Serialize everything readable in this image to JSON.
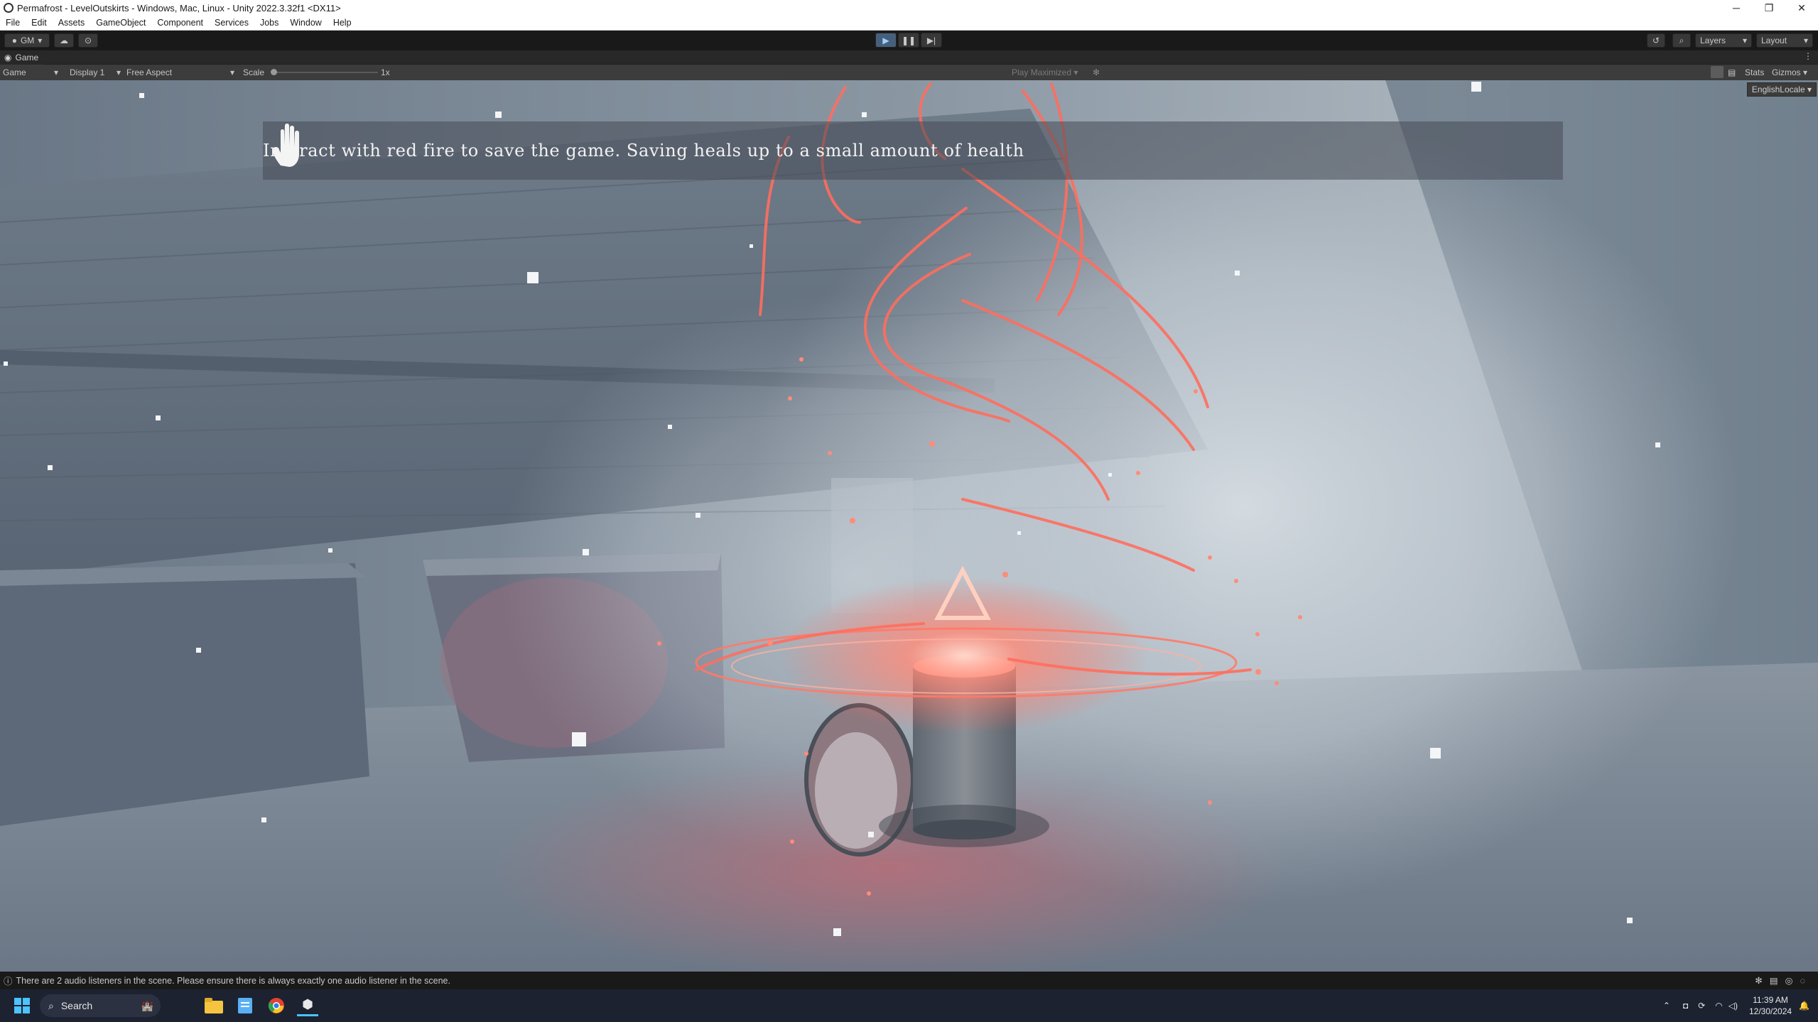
{
  "window": {
    "title": "Permafrost - LevelOutskirts - Windows, Mac, Linux - Unity 2022.3.32f1 <DX11>",
    "minimize_glyph": "─",
    "maximize_glyph": "❐",
    "close_glyph": "✕"
  },
  "menu": [
    "File",
    "Edit",
    "Assets",
    "GameObject",
    "Component",
    "Services",
    "Jobs",
    "Window",
    "Help"
  ],
  "toolbar": {
    "account": "GM",
    "layers": "Layers",
    "layout": "Layout"
  },
  "tab": {
    "label": "Game"
  },
  "game_toolbar": {
    "mode": "Game",
    "display": "Display 1",
    "aspect": "Free Aspect",
    "scale_label": "Scale",
    "scale_value": "1x",
    "play_maximized": "Play Maximized",
    "stats": "Stats",
    "gizmos": "Gizmos"
  },
  "game_view": {
    "hint_text": "Interact with red fire to save the game. Saving heals up to a small amount of health",
    "locale": "EnglishLocale"
  },
  "status": {
    "message": "There are 2 audio listeners in the scene. Please ensure there is always exactly one audio listener in the scene."
  },
  "taskbar": {
    "search_label": "Search",
    "time": "11:39 AM",
    "date": "12/30/2024"
  },
  "colors": {
    "accent": "#46607c",
    "fire": "#ff6a5a",
    "fog": "#b9c3cc"
  }
}
